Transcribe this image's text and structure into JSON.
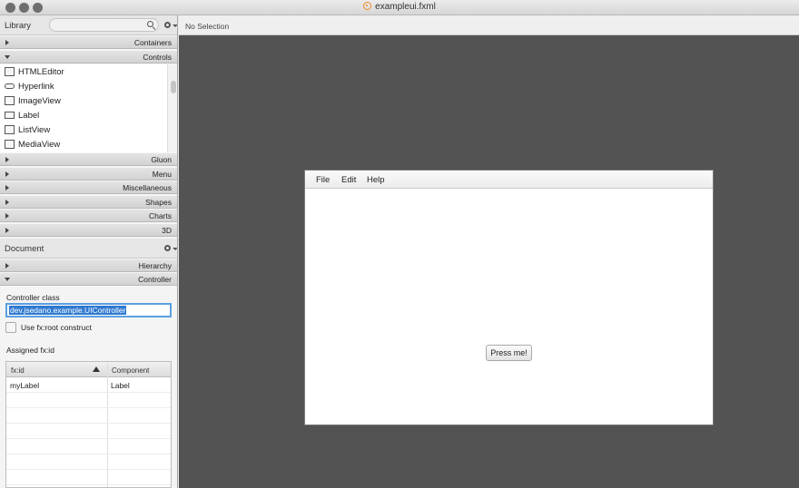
{
  "window": {
    "title": "exampleui.fxml"
  },
  "library": {
    "title": "Library",
    "search_placeholder": "",
    "sections_top": [
      {
        "label": "Containers",
        "expanded": false
      },
      {
        "label": "Controls",
        "expanded": true
      }
    ],
    "controls": [
      "HTMLEditor",
      "Hyperlink",
      "ImageView",
      "Label",
      "ListView",
      "MediaView"
    ],
    "sections_bottom": [
      {
        "label": "Gluon",
        "expanded": false
      },
      {
        "label": "Menu",
        "expanded": false
      },
      {
        "label": "Miscellaneous",
        "expanded": false
      },
      {
        "label": "Shapes",
        "expanded": false
      },
      {
        "label": "Charts",
        "expanded": false
      },
      {
        "label": "3D",
        "expanded": false
      }
    ]
  },
  "document": {
    "title": "Document",
    "sections": [
      {
        "label": "Hierarchy",
        "expanded": false
      },
      {
        "label": "Controller",
        "expanded": true
      }
    ],
    "controller": {
      "class_label": "Controller class",
      "class_value": "dev.jsedano.example.UIController",
      "use_root_label": "Use fx:root construct",
      "use_root_checked": false,
      "assigned_label": "Assigned fx:id",
      "table": {
        "headers": [
          "fx:id",
          "Component"
        ],
        "rows": [
          [
            "myLabel",
            "Label"
          ]
        ]
      }
    }
  },
  "editor": {
    "selection_status": "No Selection",
    "menus": [
      "File",
      "Edit",
      "Help"
    ],
    "button_label": "Press me!"
  },
  "colors": {
    "canvas": "#535353",
    "accent": "#2f79d0",
    "fx_orange": "#f08a24"
  }
}
